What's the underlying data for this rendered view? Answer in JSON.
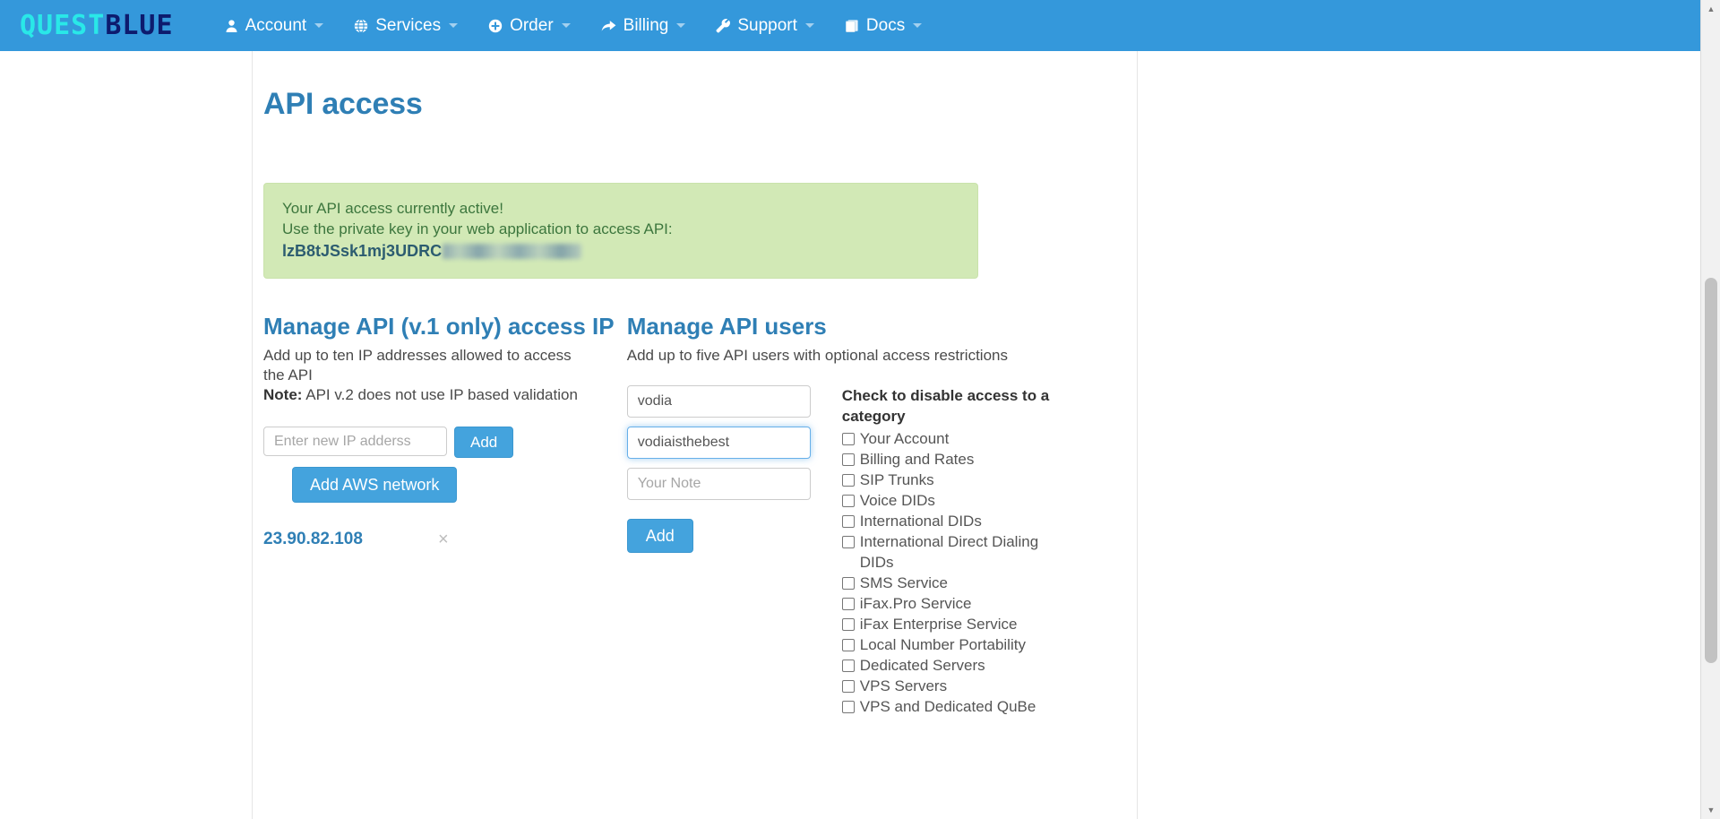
{
  "navbar": {
    "brand": {
      "part1": "QUEST",
      "part2": "BLUE"
    },
    "items": [
      {
        "label": "Account",
        "icon": "user-icon",
        "caret": true
      },
      {
        "label": "Services",
        "icon": "globe-icon",
        "caret": true
      },
      {
        "label": "Order",
        "icon": "plus-circle-icon",
        "caret": true
      },
      {
        "label": "Billing",
        "icon": "share-icon",
        "caret": true
      },
      {
        "label": "Support",
        "icon": "wrench-icon",
        "caret": true
      },
      {
        "label": "Docs",
        "icon": "book-icon",
        "caret": true
      }
    ]
  },
  "page": {
    "title": "API access"
  },
  "alert": {
    "line1": "Your API access currently active!",
    "line2": "Use the private key in your web application to access API:",
    "key_visible": "lzB8tJSsk1mj3UDRC"
  },
  "ip_panel": {
    "heading": "Manage API (v.1 only) access IP",
    "description": "Add up to ten IP addresses allowed to access the API",
    "note_label": "Note:",
    "note_text": " API v.2 does not use IP based validation",
    "input_placeholder": "Enter new IP adderss",
    "input_value": "",
    "add_label": "Add",
    "aws_label": "Add AWS network",
    "ip_list": [
      {
        "address": "23.90.82.108",
        "remove": "×"
      }
    ]
  },
  "users_panel": {
    "heading": "Manage API users",
    "description": "Add up to five API users with optional access restrictions",
    "username_value": "vodia",
    "password_value": "vodiaisthebest",
    "note_placeholder": "Your Note",
    "note_value": "",
    "add_label": "Add",
    "categories_title": "Check to disable access to a category",
    "categories": [
      "Your Account",
      "Billing and Rates",
      "SIP Trunks",
      "Voice DIDs",
      "International DIDs",
      "International Direct Dialing DIDs",
      "SMS Service",
      "iFax.Pro Service",
      "iFax Enterprise Service",
      "Local Number Portability",
      "Dedicated Servers",
      "VPS Servers",
      "VPS and Dedicated QuBe"
    ]
  },
  "colors": {
    "brand_blue": "#3498db",
    "heading_blue": "#2f7fb5",
    "alert_green_bg": "#d2e9b6",
    "alert_green_text": "#3c763d",
    "button_blue": "#44a3dd"
  }
}
